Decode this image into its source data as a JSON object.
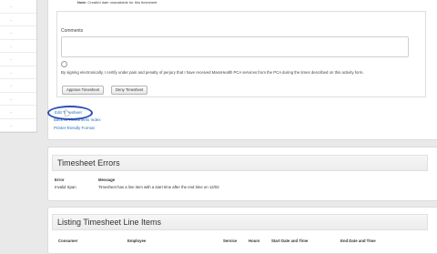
{
  "left_panel": {
    "rows": [
      "--",
      "--",
      "--",
      "--",
      "--",
      "--",
      "--",
      "--",
      "--",
      "--"
    ]
  },
  "timesheet": {
    "note_label": "Note:",
    "note_text": "Created date unavailable for this timesheet",
    "comments_label": "Comments",
    "comments_value": "",
    "attestation": "By signing electronically, I certify under pain and penalty of perjury that I have received MassHealth PCA services from the PCA during the times described on this activity form.",
    "approve_label": "Approve Timesheet",
    "deny_label": "Deny Timesheet"
  },
  "links": {
    "submit": "Edit Timesheet",
    "back": "Back to Timesheets Index",
    "printer": "Printer-friendly Format"
  },
  "errors": {
    "title": "Timesheet Errors",
    "columns": [
      "Error",
      "Message"
    ],
    "rows": [
      {
        "error": "Invalid Span",
        "message": "Timesheet has a line item with a start time after the end time on 12/02"
      }
    ]
  },
  "line_items": {
    "title": "Listing Timesheet Line Items",
    "columns": [
      "Consumer",
      "Employee",
      "Service",
      "Hours",
      "Start Date and Time",
      "End Date and Time"
    ]
  },
  "colors": {
    "link": "#2a6fbf",
    "highlight": "#2b4fb8",
    "background": "#e9e9e9"
  }
}
